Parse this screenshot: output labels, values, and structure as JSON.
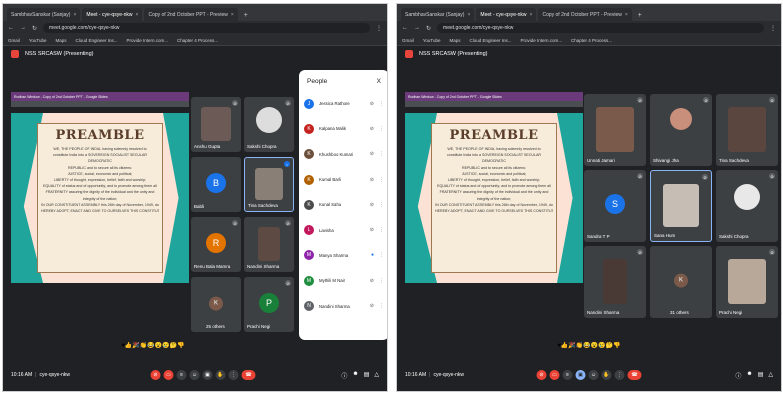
{
  "browser": {
    "tabs": [
      "SambhavSanskar (Sanjay)",
      "Meet - cye-qsye-nkw",
      "Copy of 2nd October PPT - Preview",
      "+"
    ],
    "url": "meet.google.com/cye-qsye-nkw",
    "bookmarks": [
      "Gmail",
      "YouTube",
      "Maps",
      "Cloud Engineer Ins...",
      "Provide Intern.com...",
      "Chapter 4 Process..."
    ]
  },
  "meeting": {
    "title": "NSS SRCASW (Presenting)",
    "code": "cye-qsye-nkw",
    "time": "10:16 AM"
  },
  "slide": {
    "window_title": "Rodhan Window - Copy of 2nd October PPT - Google Slides",
    "title": "PREAMBLE",
    "lines": [
      "WE, THE PEOPLE OF INDIA, having solemnly resolved to",
      "constitute India into a SOVEREIGN SOCIALIST SECULAR",
      "DEMOCRATIC",
      "REPUBLIC and to secure all its citizens:",
      "JUSTICE, social, economic and political;",
      "LIBERTY of thought, expression, belief, faith and worship;",
      "EQUALITY of status and of opportunity; and to promote among them all",
      "FRATERNITY assuring the dignity of the individual and the unity and",
      "integrity of the nation;",
      "IN OUR CONSTITUENT ASSEMBLY this 26th day of November, 1949, do",
      "HEREBY ADOPT, ENACT AND GIVE TO OURSELVES THIS CONSTITUTION"
    ]
  },
  "left_tiles": [
    {
      "name": "Anshu Gupta"
    },
    {
      "name": "Sakshi Chopra"
    },
    {
      "name": "Babli",
      "initial": "B"
    },
    {
      "name": "Tina Sachdeva"
    },
    {
      "name": "Renu Bala Mamra",
      "initial": "R"
    },
    {
      "name": "Nandini Sharma"
    },
    {
      "name": "25 others",
      "initial": "K"
    },
    {
      "name": "Prachi Negi",
      "initial": "P"
    }
  ],
  "people_panel": {
    "title": "People",
    "close": "X",
    "people": [
      {
        "name": "Jessica Rathore",
        "initial": "J"
      },
      {
        "name": "Kalpana Malik",
        "initial": "K"
      },
      {
        "name": "Khushboo Kumari",
        "initial": "K"
      },
      {
        "name": "Kumal Barli",
        "initial": "K"
      },
      {
        "name": "Kunal Sahu",
        "initial": "K"
      },
      {
        "name": "Lavisha",
        "initial": "L"
      },
      {
        "name": "Manya Sharma",
        "initial": "M"
      },
      {
        "name": "Mythili M Nair",
        "initial": "M"
      },
      {
        "name": "Nandini Sharma",
        "initial": "N"
      }
    ]
  },
  "right_tiles": [
    {
      "name": "Unnati Jamari"
    },
    {
      "name": "Shivangi Jha"
    },
    {
      "name": "Tina Sachdeva"
    },
    {
      "name": "Sandra T P",
      "initial": "S"
    },
    {
      "name": "Sana Hum"
    },
    {
      "name": "Sakshi Chopra"
    },
    {
      "name": "Nandini Sharma"
    },
    {
      "name": "31 others",
      "initial": "K"
    },
    {
      "name": "Prachi Negi"
    }
  ],
  "reactions": "♥👍🎉👏😂😮😢🤔👎",
  "colors": {
    "accent": "#1a73e8",
    "end": "#ea4335",
    "teal": "#1fa59b"
  }
}
